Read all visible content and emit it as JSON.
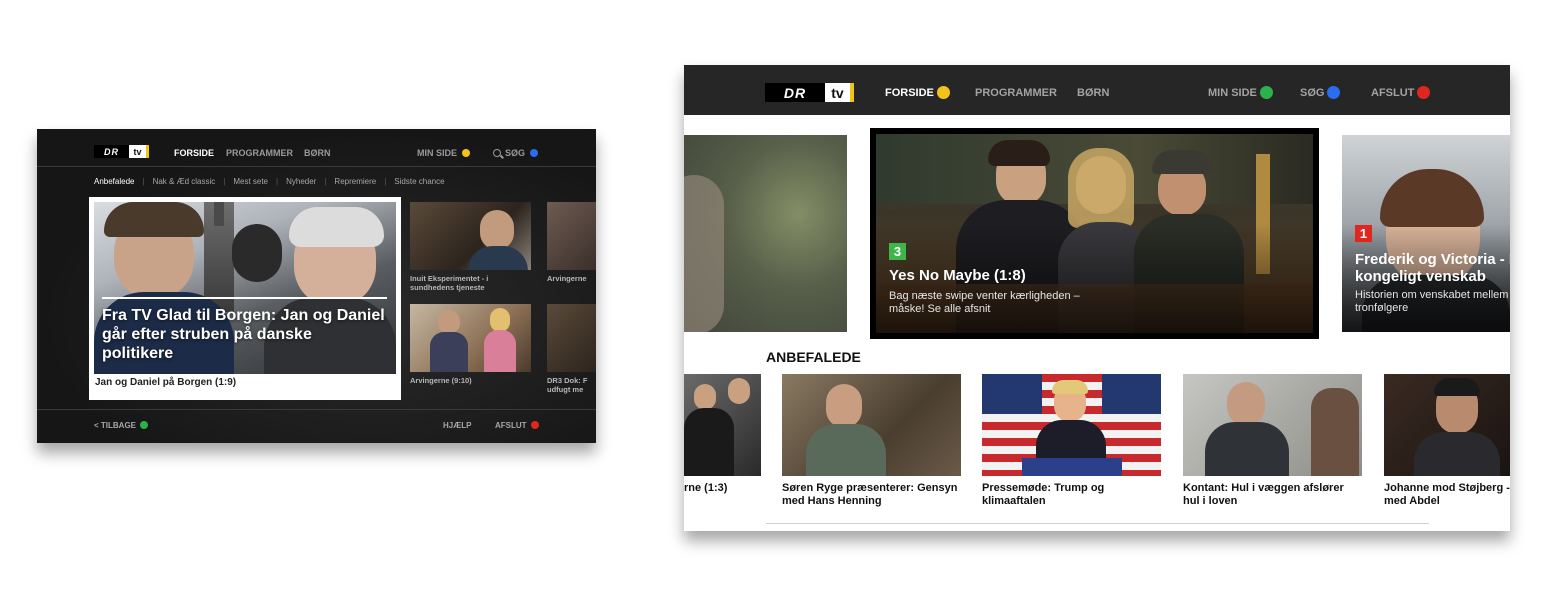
{
  "old_screen": {
    "logo": {
      "dr": "DR",
      "tv": "tv"
    },
    "nav": {
      "forside": "FORSIDE",
      "programmer": "PROGRAMMER",
      "born": "BØRN",
      "min_side": "MIN SIDE",
      "sog": "SØG"
    },
    "subnav": [
      "Anbefalede",
      "Nak & Æd classic",
      "Mest sete",
      "Nyheder",
      "Repremiere",
      "Sidste chance"
    ],
    "featured": {
      "headline": "Fra TV Glad til Borgen: Jan og Daniel går efter struben på danske politikere",
      "caption": "Jan og Daniel på Borgen (1:9)"
    },
    "tiles": [
      {
        "caption": "Inuit Eksperimentet - i sundhedens tjeneste"
      },
      {
        "caption": "Arvingerne"
      },
      {
        "caption": "Arvingerne (9:10)"
      },
      {
        "caption": "DR3 Dok: F udfugt me"
      }
    ],
    "bottom": {
      "tilbage": "< TILBAGE",
      "hjaelp": "HJÆLP",
      "afslut": "AFSLUT"
    }
  },
  "new_screen": {
    "logo": {
      "dr": "DR",
      "tv": "tv"
    },
    "nav": {
      "forside": "FORSIDE",
      "programmer": "PROGRAMMER",
      "born": "BØRN",
      "min_side": "MIN SIDE",
      "sog": "SØG",
      "afslut": "AFSLUT"
    },
    "hero_cards": [
      {
        "badge": "3",
        "title": "Yes No Maybe (1:8)",
        "description": "Bag næste swipe venter kærligheden – måske! Se alle afsnit"
      },
      {
        "badge": "1",
        "title": "Frederik og Victoria - I kongeligt venskab",
        "description": "Historien om venskabet mellem tronfølgere"
      }
    ],
    "section_title": "ANBEFALEDE",
    "tiles": [
      {
        "caption": "rne (1:3)"
      },
      {
        "caption": "Søren Ryge præsenterer: Gensyn med Hans Henning"
      },
      {
        "caption": "Pressemøde: Trump og klimaaftalen"
      },
      {
        "caption": "Kontant: Hul i væggen afslører hul i loven"
      },
      {
        "caption": "Johanne mod Støjberg - med Abdel"
      }
    ]
  },
  "colors": {
    "yellow": "#f4c31b",
    "blue": "#2a6cf2",
    "green": "#2bb24c",
    "red": "#e0271f",
    "topbar": "#262626"
  }
}
